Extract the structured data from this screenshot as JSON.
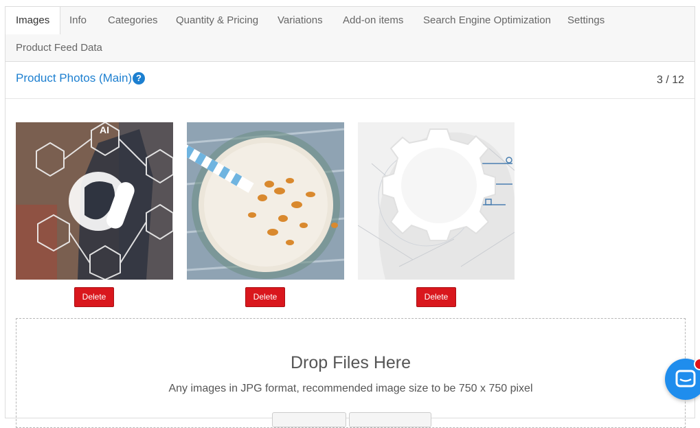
{
  "tabs": [
    {
      "label": "Images",
      "active": true
    },
    {
      "label": "Info"
    },
    {
      "label": "Categories"
    },
    {
      "label": "Quantity & Pricing"
    },
    {
      "label": "Variations"
    },
    {
      "label": "Add-on items"
    },
    {
      "label": "Search Engine Optimization"
    },
    {
      "label": "Settings"
    },
    {
      "label": "Product Feed Data"
    }
  ],
  "panel": {
    "title": "Product Photos (Main)",
    "help_icon": "question-circle-icon",
    "counter": "3 / 12"
  },
  "photos": [
    {
      "image": "technology-network-businessman",
      "delete_label": "Delete"
    },
    {
      "image": "smoothie-with-straw",
      "delete_label": "Delete"
    },
    {
      "image": "gear-head-network",
      "delete_label": "Delete"
    }
  ],
  "dropzone": {
    "title": "Drop Files Here",
    "subtitle": "Any images in JPG format, recommended image size to be 750 x 750 pixel"
  },
  "chat_widget": {
    "icon": "chat-bubble-icon"
  },
  "colors": {
    "accent": "#1c7fd0",
    "danger": "#d9171d",
    "chat": "#1f8ded"
  }
}
